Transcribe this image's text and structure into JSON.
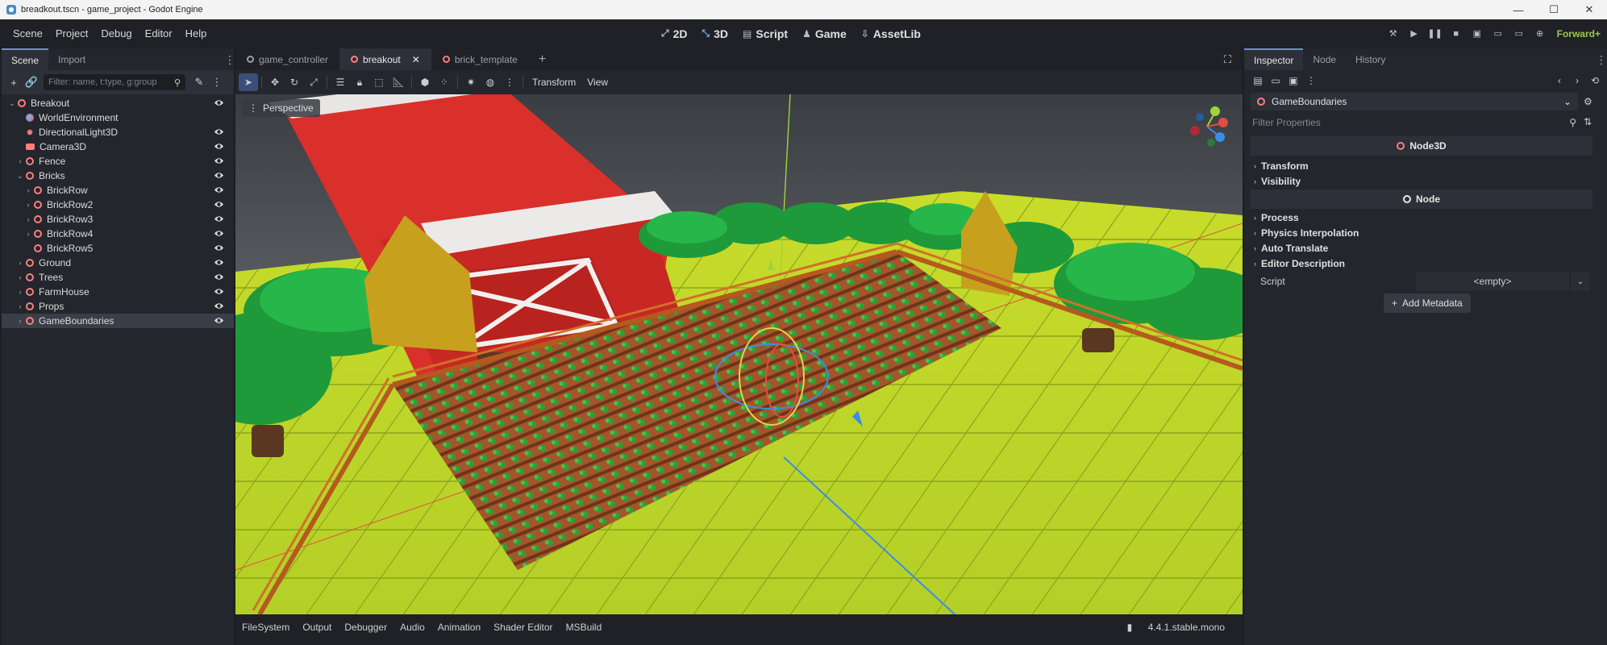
{
  "window": {
    "title": "breadkout.tscn - game_project - Godot Engine",
    "buttons": [
      "—",
      "☐",
      "✕"
    ]
  },
  "menubar": {
    "menus": [
      "Scene",
      "Project",
      "Debug",
      "Editor",
      "Help"
    ],
    "modes": [
      {
        "label": "2D",
        "icon": "2d-mode-icon"
      },
      {
        "label": "3D",
        "icon": "3d-mode-icon"
      },
      {
        "label": "Script",
        "icon": "script-icon"
      },
      {
        "label": "Game",
        "icon": "game-icon"
      },
      {
        "label": "AssetLib",
        "icon": "assetlib-icon"
      }
    ],
    "renderer": "Forward+"
  },
  "scene_dock": {
    "tabs": [
      "Scene",
      "Import"
    ],
    "filter_placeholder": "Filter: name, t:type, g:group",
    "tree": [
      {
        "label": "Breakout",
        "expanded": true
      },
      {
        "label": "WorldEnvironment"
      },
      {
        "label": "DirectionalLight3D"
      },
      {
        "label": "Camera3D"
      },
      {
        "label": "Fence"
      },
      {
        "label": "Bricks",
        "expanded": true
      },
      {
        "label": "BrickRow"
      },
      {
        "label": "BrickRow2"
      },
      {
        "label": "BrickRow3"
      },
      {
        "label": "BrickRow4"
      },
      {
        "label": "BrickRow5"
      },
      {
        "label": "Ground"
      },
      {
        "label": "Trees"
      },
      {
        "label": "FarmHouse"
      },
      {
        "label": "Props"
      },
      {
        "label": "GameBoundaries",
        "selected": true
      }
    ]
  },
  "editor": {
    "doc_tabs": [
      "game_controller",
      "breakout",
      "brick_template"
    ],
    "toolbar_menus": [
      "Transform",
      "View"
    ],
    "viewport_label": "Perspective",
    "bottom_tabs": [
      "FileSystem",
      "Output",
      "Debugger",
      "Audio",
      "Animation",
      "Shader Editor",
      "MSBuild"
    ],
    "version": "4.4.1.stable.mono"
  },
  "inspector": {
    "tabs": [
      "Inspector",
      "Node",
      "History"
    ],
    "selected_node": "GameBoundaries",
    "filter_placeholder": "Filter Properties",
    "class_header": "Node3D",
    "node3d_sections": [
      "Transform",
      "Visibility"
    ],
    "node_header": "Node",
    "node_sections": [
      "Process",
      "Physics Interpolation",
      "Auto Translate",
      "Editor Description"
    ],
    "script_label": "Script",
    "script_value": "<empty>",
    "add_metadata": "Add Metadata"
  },
  "colors": {
    "accent": "#6d8fd6",
    "node3d": "#fc7f7f",
    "renderer": "#9ec84a"
  }
}
